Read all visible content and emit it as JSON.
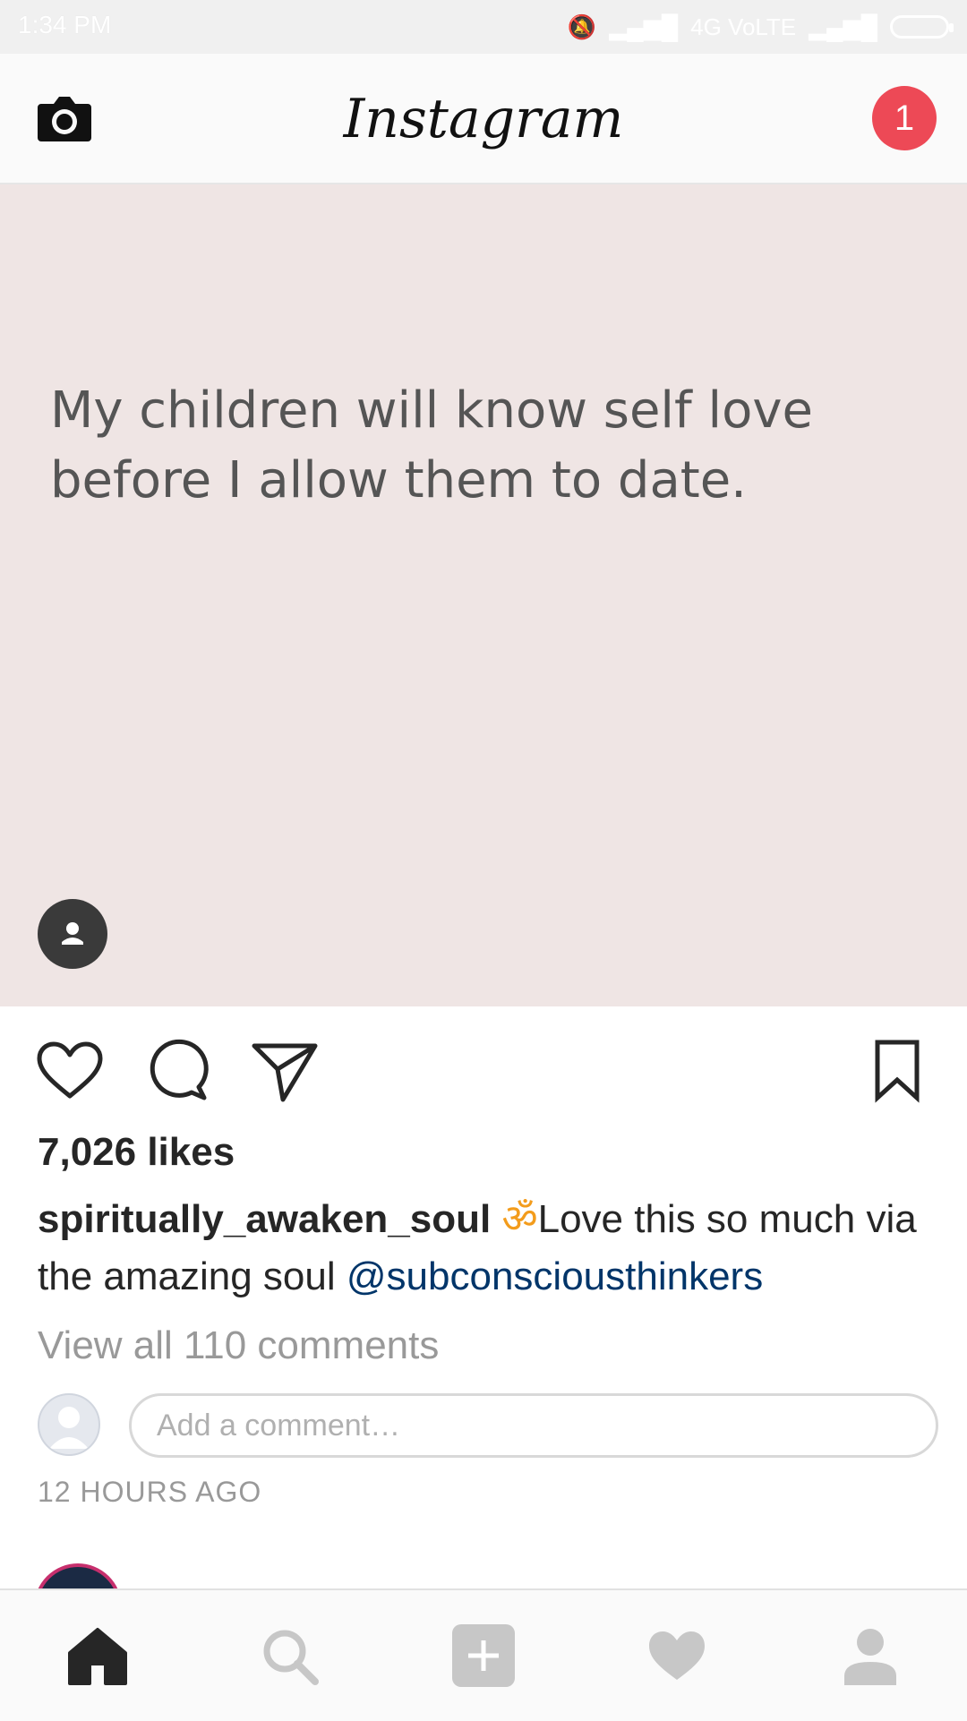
{
  "status_bar": {
    "time": "1:34 PM",
    "network": "4G VoLTE"
  },
  "header": {
    "logo": "Instagram",
    "notification_count": "1"
  },
  "post": {
    "image_text": "My children will know self love before I allow them to date.",
    "likes": "7,026 likes",
    "caption": {
      "username": "spiritually_awaken_soul",
      "om": "ॐ",
      "text": "Love this so much via the amazing soul ",
      "mention": "@subconsciousthinkers"
    },
    "view_comments": "View all 110 comments",
    "comment_placeholder": "Add a comment…",
    "timestamp": "12 HOURS AGO"
  },
  "icons": {
    "camera": "camera-icon",
    "like": "heart-outline-icon",
    "comment": "comment-icon",
    "share": "paper-plane-icon",
    "save": "bookmark-icon",
    "tag": "user-tag-icon",
    "nav": [
      "home-icon",
      "search-icon",
      "add-icon",
      "activity-heart-icon",
      "profile-icon"
    ]
  },
  "colors": {
    "badge": "#ed4956",
    "mention": "#003569",
    "muted": "#999999",
    "image_bg": "#efe5e4"
  }
}
